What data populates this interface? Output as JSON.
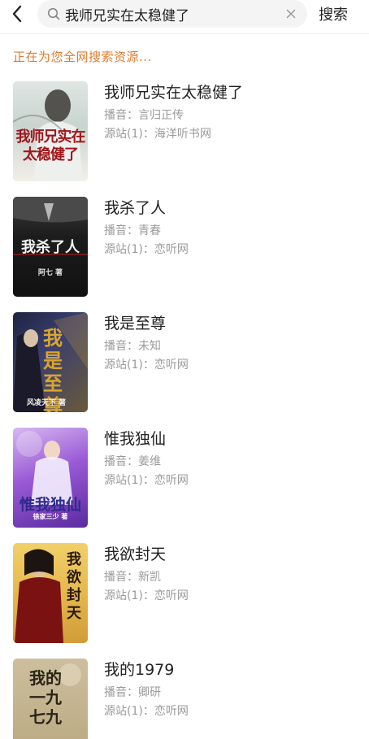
{
  "header": {
    "search_value": "我师兄实在太稳健了",
    "search_button": "搜索"
  },
  "status": "正在为您全网搜索资源...",
  "results": [
    {
      "title": "我师兄实在太稳健了",
      "narrator_label": "播音：言归正传",
      "source_label": "源站(1)：海洋听书网",
      "cover_text": "我师兄实在太稳健了"
    },
    {
      "title": "我杀了人",
      "narrator_label": "播音：青春",
      "source_label": "源站(1)：恋听网",
      "cover_text": "我杀了人",
      "cover_author": "阿七 著"
    },
    {
      "title": "我是至尊",
      "narrator_label": "播音：未知",
      "source_label": "源站(1)：恋听网",
      "cover_text": "我是至尊",
      "cover_author": "风凌天下 著"
    },
    {
      "title": "惟我独仙",
      "narrator_label": "播音：姜维",
      "source_label": "源站(1)：恋听网",
      "cover_text": "惟我独仙",
      "cover_author": "徐家三少 著"
    },
    {
      "title": "我欲封天",
      "narrator_label": "播音：新凯",
      "source_label": "源站(1)：恋听网",
      "cover_text": "我欲封天"
    },
    {
      "title": "我的1979",
      "narrator_label": "播音：卿研",
      "source_label": "源站(1)：恋听网",
      "cover_text": "我的一九七九"
    }
  ]
}
